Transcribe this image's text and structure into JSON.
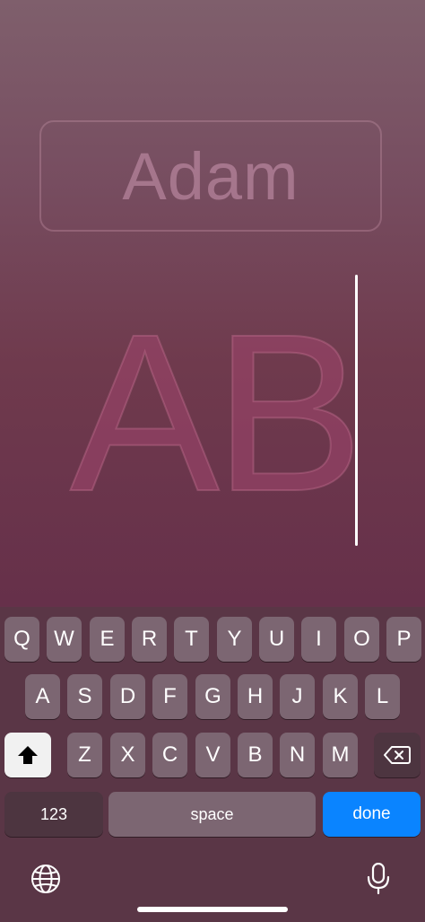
{
  "editor": {
    "name": "Adam",
    "initials": "AB"
  },
  "keyboard": {
    "row1": [
      "Q",
      "W",
      "E",
      "R",
      "T",
      "Y",
      "U",
      "I",
      "O",
      "P"
    ],
    "row2": [
      "A",
      "S",
      "D",
      "F",
      "G",
      "H",
      "J",
      "K",
      "L"
    ],
    "row3": [
      "Z",
      "X",
      "C",
      "V",
      "B",
      "N",
      "M"
    ],
    "numbers_label": "123",
    "space_label": "space",
    "done_label": "done"
  },
  "colors": {
    "accent": "#0a84ff",
    "key_background": "#7c6672",
    "keyboard_background": "#5a3646"
  },
  "icons": [
    "shift-icon",
    "backspace-icon",
    "globe-icon",
    "microphone-icon"
  ]
}
